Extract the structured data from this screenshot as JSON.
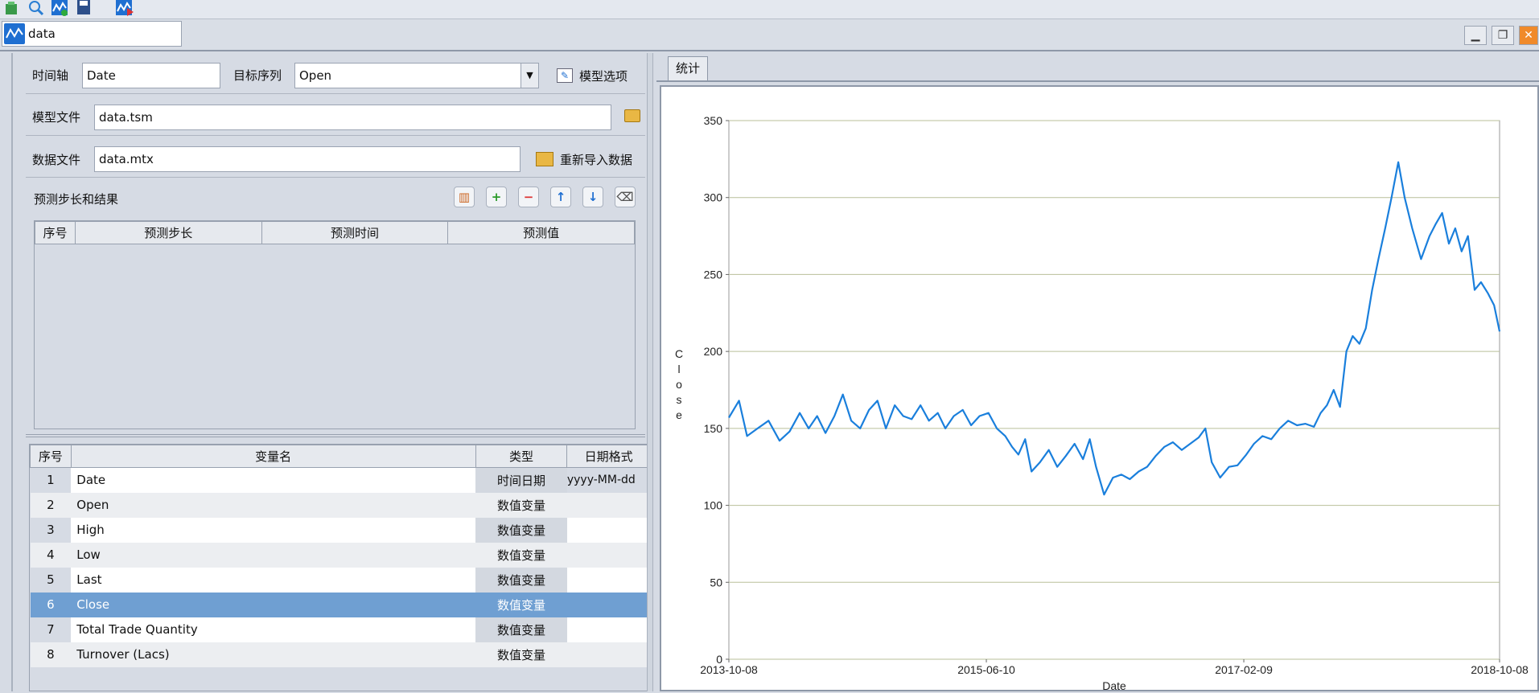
{
  "toolbar": {
    "icons": [
      "data-cube-icon",
      "search-icon",
      "chart-add-icon",
      "save-icon",
      "chart-run-icon"
    ]
  },
  "document_tab": {
    "label": "data"
  },
  "settings": {
    "time_axis_label": "时间轴",
    "time_axis_value": "Date",
    "target_series_label": "目标序列",
    "target_series_value": "Open",
    "model_options_label": "模型选项",
    "model_file_label": "模型文件",
    "model_file_value": "data.tsm",
    "data_file_label": "数据文件",
    "data_file_value": "data.mtx",
    "reimport_label": "重新导入数据"
  },
  "forecast": {
    "title": "预测步长和结果",
    "columns": [
      "序号",
      "预测步长",
      "预测时间",
      "预测值"
    ]
  },
  "variables": {
    "columns": [
      "序号",
      "变量名",
      "类型",
      "日期格式"
    ],
    "rows": [
      {
        "idx": "1",
        "name": "Date",
        "type": "时间日期",
        "format": "yyyy-MM-dd"
      },
      {
        "idx": "2",
        "name": "Open",
        "type": "数值变量",
        "format": ""
      },
      {
        "idx": "3",
        "name": "High",
        "type": "数值变量",
        "format": ""
      },
      {
        "idx": "4",
        "name": "Low",
        "type": "数值变量",
        "format": ""
      },
      {
        "idx": "5",
        "name": "Last",
        "type": "数值变量",
        "format": ""
      },
      {
        "idx": "6",
        "name": "Close",
        "type": "数值变量",
        "format": ""
      },
      {
        "idx": "7",
        "name": "Total Trade Quantity",
        "type": "数值变量",
        "format": ""
      },
      {
        "idx": "8",
        "name": "Turnover (Lacs)",
        "type": "数值变量",
        "format": ""
      }
    ],
    "selected_index": 5
  },
  "stats_tab": {
    "label": "统计"
  },
  "chart_data": {
    "type": "line",
    "xlabel": "Date",
    "ylabel": "Close",
    "ylim": [
      0,
      350
    ],
    "yticks": [
      0,
      50,
      100,
      150,
      200,
      250,
      300,
      350
    ],
    "xlim": [
      "2013-10-08",
      "2018-10-08"
    ],
    "xticks": [
      "2013-10-08",
      "2015-06-10",
      "2017-02-09",
      "2018-10-08"
    ],
    "grid": true,
    "series_color": "#1a7fdc",
    "series": [
      {
        "x": [
          "2013-10-08",
          "2013-11-01",
          "2013-11-20",
          "2013-12-15",
          "2014-01-10",
          "2014-02-05",
          "2014-03-01",
          "2014-03-25",
          "2014-04-15",
          "2014-05-05",
          "2014-05-25",
          "2014-06-15",
          "2014-07-05",
          "2014-07-25",
          "2014-08-15",
          "2014-09-05",
          "2014-09-25",
          "2014-10-15",
          "2014-11-05",
          "2014-11-25",
          "2014-12-15",
          "2015-01-05",
          "2015-01-25",
          "2015-02-15",
          "2015-03-05",
          "2015-03-25",
          "2015-04-15",
          "2015-05-05",
          "2015-05-25",
          "2015-06-15",
          "2015-07-05",
          "2015-07-25",
          "2015-08-10",
          "2015-08-25",
          "2015-09-10",
          "2015-09-25",
          "2015-10-15",
          "2015-11-05",
          "2015-11-25",
          "2015-12-15",
          "2016-01-05",
          "2016-01-25",
          "2016-02-10",
          "2016-02-25",
          "2016-03-15",
          "2016-04-05",
          "2016-04-25",
          "2016-05-15",
          "2016-06-05",
          "2016-06-25",
          "2016-07-15",
          "2016-08-05",
          "2016-08-25",
          "2016-09-15",
          "2016-10-05",
          "2016-10-25",
          "2016-11-10",
          "2016-11-25",
          "2016-12-15",
          "2017-01-05",
          "2017-01-25",
          "2017-02-15",
          "2017-03-05",
          "2017-03-25",
          "2017-04-15",
          "2017-05-05",
          "2017-05-25",
          "2017-06-15",
          "2017-07-05",
          "2017-07-25",
          "2017-08-10",
          "2017-08-25",
          "2017-09-10",
          "2017-09-25",
          "2017-10-10",
          "2017-10-25",
          "2017-11-10",
          "2017-11-25",
          "2017-12-10",
          "2017-12-25",
          "2018-01-10",
          "2018-01-25",
          "2018-02-10",
          "2018-02-25",
          "2018-03-15",
          "2018-04-05",
          "2018-04-25",
          "2018-05-10",
          "2018-05-25",
          "2018-06-10",
          "2018-06-25",
          "2018-07-10",
          "2018-07-25",
          "2018-08-10",
          "2018-08-25",
          "2018-09-10",
          "2018-09-25",
          "2018-10-08"
        ],
        "values": [
          157,
          168,
          145,
          150,
          155,
          142,
          148,
          160,
          150,
          158,
          147,
          158,
          172,
          155,
          150,
          162,
          168,
          150,
          165,
          158,
          156,
          165,
          155,
          160,
          150,
          158,
          162,
          152,
          158,
          160,
          150,
          145,
          138,
          133,
          143,
          122,
          128,
          136,
          125,
          132,
          140,
          130,
          143,
          125,
          107,
          118,
          120,
          117,
          122,
          125,
          132,
          138,
          141,
          136,
          140,
          144,
          150,
          128,
          118,
          125,
          126,
          133,
          140,
          145,
          143,
          150,
          155,
          152,
          153,
          151,
          160,
          165,
          175,
          164,
          200,
          210,
          205,
          215,
          240,
          260,
          280,
          300,
          323,
          300,
          280,
          260,
          275,
          283,
          290,
          270,
          280,
          265,
          275,
          240,
          245,
          238,
          230,
          213
        ]
      }
    ]
  }
}
